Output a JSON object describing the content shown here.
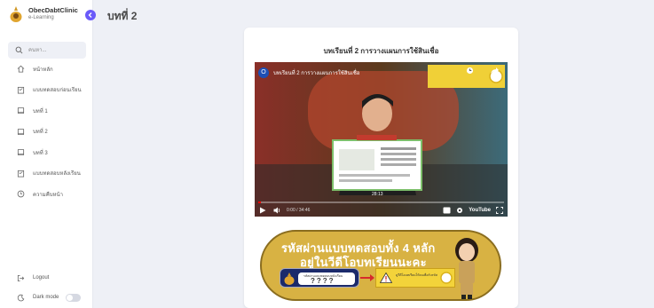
{
  "app": {
    "name": "ObecDabtClinic",
    "subtitle": "e-Learning",
    "collapse_icon": "chevron-left-icon"
  },
  "search": {
    "placeholder": "ค้นหา..."
  },
  "nav": {
    "items": [
      {
        "label": "หน้าหลัก",
        "icon": "home-icon"
      },
      {
        "label": "แบบทดสอบก่อนเรียน",
        "icon": "clipboard-icon"
      },
      {
        "label": "บทที่ 1",
        "icon": "book-icon"
      },
      {
        "label": "บทที่ 2",
        "icon": "book-icon"
      },
      {
        "label": "บทที่ 3",
        "icon": "book-icon"
      },
      {
        "label": "แบบทดสอบหลังเรียน",
        "icon": "clipboard-icon"
      },
      {
        "label": "ความคืบหน้า",
        "icon": "clock-icon"
      }
    ]
  },
  "bottom": {
    "logout": "Logout",
    "dark_mode": "Dark mode",
    "dark_mode_on": false
  },
  "page": {
    "title": "บทที่ 2"
  },
  "lesson": {
    "title": "บทเรียนที่ 2 การวางแผนการใช้สินเชื่อ",
    "video": {
      "channel_initial": "O",
      "title": "บทเรียนที่ 2 การวางแผนการใช้สินเชื่อ",
      "elapsed": "0:00 / 34:46",
      "overlay_time": "28:13",
      "provider": "YouTube",
      "progress_fraction": 0.01
    },
    "banner": {
      "line1": "รหัสผ่านแบบทดสอบทั้ง 4 หลัก",
      "line2": "อยู่ในวีดีโอบทเรียนนะคะ",
      "code_label": "รหัสผ่านแบบทดสอบหลังเรียน",
      "code_value": "????",
      "warning_text": "ดูวีดีโอบทเรียนให้จบเพื่อรับรหัส"
    }
  },
  "colors": {
    "accent": "#6a5af9",
    "banner_gold": "#d8b243",
    "page_bg": "#eef0f6"
  }
}
